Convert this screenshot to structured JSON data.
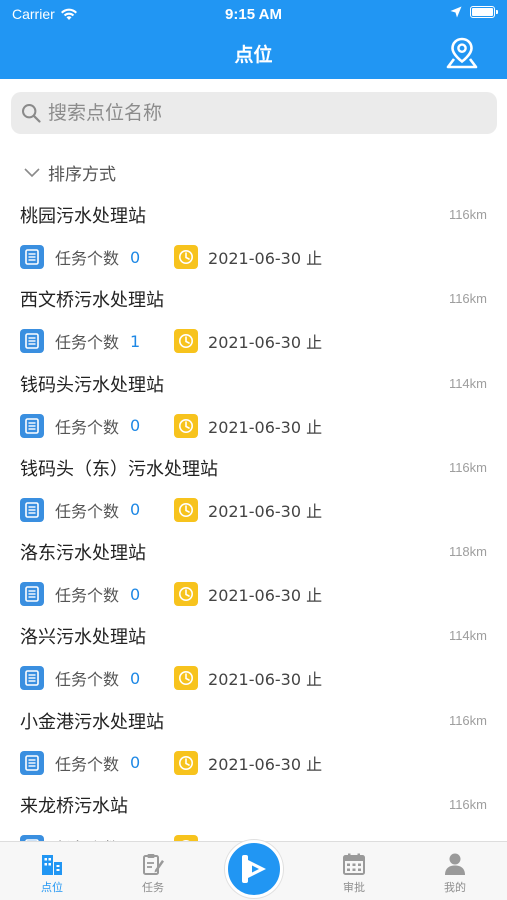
{
  "status_bar": {
    "carrier": "Carrier",
    "time": "9:15 AM"
  },
  "nav": {
    "title": "点位"
  },
  "search": {
    "placeholder": "搜索点位名称"
  },
  "sort": {
    "label": "排序方式"
  },
  "meta_label": "任务个数",
  "stations": [
    {
      "name": "桃园污水处理站",
      "distance": "116km",
      "task_count": "0",
      "date": "2021-06-30 止"
    },
    {
      "name": "西文桥污水处理站",
      "distance": "116km",
      "task_count": "1",
      "date": "2021-06-30 止"
    },
    {
      "name": "钱码头污水处理站",
      "distance": "114km",
      "task_count": "0",
      "date": "2021-06-30 止"
    },
    {
      "name": "钱码头（东）污水处理站",
      "distance": "116km",
      "task_count": "0",
      "date": "2021-06-30 止"
    },
    {
      "name": "洛东污水处理站",
      "distance": "118km",
      "task_count": "0",
      "date": "2021-06-30 止"
    },
    {
      "name": "洛兴污水处理站",
      "distance": "114km",
      "task_count": "0",
      "date": "2021-06-30 止"
    },
    {
      "name": "小金港污水处理站",
      "distance": "116km",
      "task_count": "0",
      "date": "2021-06-30 止"
    },
    {
      "name": "来龙桥污水站",
      "distance": "116km",
      "task_count": "",
      "date": ""
    }
  ],
  "tabs": [
    {
      "label": "点位",
      "icon": "building-icon"
    },
    {
      "label": "任务",
      "icon": "clipboard-icon"
    },
    {
      "label": "",
      "icon": "app-logo-icon"
    },
    {
      "label": "审批",
      "icon": "calendar-icon"
    },
    {
      "label": "我的",
      "icon": "user-icon"
    }
  ],
  "colors": {
    "primary": "#2196F3",
    "count": "#1E88E5",
    "doc_icon": "#3A8FE0",
    "clock_icon": "#F7C31D"
  }
}
